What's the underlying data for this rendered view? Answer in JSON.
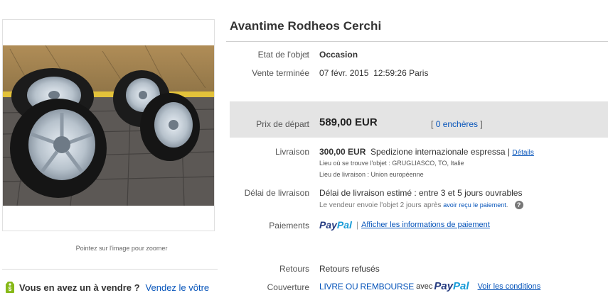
{
  "item": {
    "title": "Avantime Rodheos Cerchi"
  },
  "photo": {
    "zoom_hint": "Pointez sur l'image pour zoomer"
  },
  "sell": {
    "question": "Vous en avez un à vendre ?",
    "link": "Vendez le vôtre"
  },
  "condition": {
    "label": "Etat de l'objet",
    "colon": ":",
    "value": "Occasion"
  },
  "ended": {
    "label": "Vente terminée",
    "colon": ":",
    "date": "07 févr. 2015",
    "time": "12:59:26 Paris"
  },
  "price": {
    "label": "Prix de départ",
    "colon": ":",
    "value": "589,00 EUR",
    "bids_open": "[",
    "bids_link": "0 enchères",
    "bids_close": "]"
  },
  "shipping": {
    "label": "Livraison",
    "colon": ":",
    "cost": "300,00 EUR",
    "method": "Spedizione internazionale espressa",
    "sep": "|",
    "details": "Détails",
    "location": "Lieu où se trouve l'objet : GRUGLIASCO, TO, Italie",
    "delivery_area": "Lieu de livraison : Union européenne"
  },
  "delivery": {
    "label": "Délai de livraison",
    "colon": ":",
    "estimate": "Délai de livraison estimé : entre 3 et 5 jours ouvrables",
    "note": "Le vendeur envoie l'objet 2 jours après",
    "note_link": "avoir reçu le paiement",
    "note_end": "."
  },
  "payments": {
    "label": "Paiements",
    "colon": ":",
    "paypal_a": "Pay",
    "paypal_b": "Pal",
    "sep": "|",
    "info_link": "Afficher les informations de paiement"
  },
  "returns": {
    "label": "Retours",
    "colon": ":",
    "value": "Retours refusés"
  },
  "coverage": {
    "label": "Couverture",
    "colon": ":",
    "guarantee": "LIVRE OU REMBOURSE",
    "with": "avec",
    "paypal_a": "Pay",
    "paypal_b": "Pal",
    "conditions": "Voir les conditions"
  },
  "colors": {
    "link": "#0654ba",
    "paypal_dark": "#253b80",
    "paypal_light": "#179bd7",
    "band": "#e4e4e4"
  }
}
